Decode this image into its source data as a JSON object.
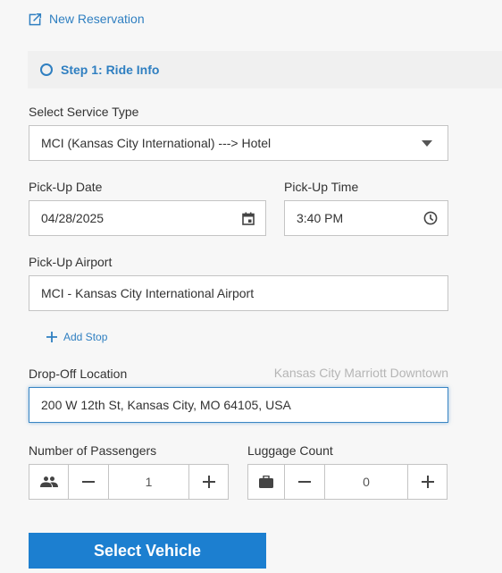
{
  "header": {
    "new_reservation_label": "New Reservation"
  },
  "step": {
    "label": "Step 1: Ride Info"
  },
  "service_type": {
    "label": "Select Service Type",
    "value": "MCI (Kansas City International) ---> Hotel"
  },
  "pickup_date": {
    "label": "Pick-Up Date",
    "value": "04/28/2025"
  },
  "pickup_time": {
    "label": "Pick-Up Time",
    "value": "3:40 PM"
  },
  "pickup_airport": {
    "label": "Pick-Up Airport",
    "value": "MCI - Kansas City International Airport"
  },
  "add_stop": {
    "label": "Add Stop"
  },
  "dropoff": {
    "label": "Drop-Off Location",
    "hint": "Kansas City Marriott Downtown",
    "value": "200 W 12th St, Kansas City, MO 64105, USA"
  },
  "passengers": {
    "label": "Number of Passengers",
    "value": "1"
  },
  "luggage": {
    "label": "Luggage Count",
    "value": "0"
  },
  "actions": {
    "select_vehicle_label": "Select Vehicle"
  },
  "colors": {
    "accent": "#2f7fc1",
    "primary_button": "#1c7fd0",
    "background": "#f7f7f7",
    "step_bar": "#f0f0f0"
  }
}
